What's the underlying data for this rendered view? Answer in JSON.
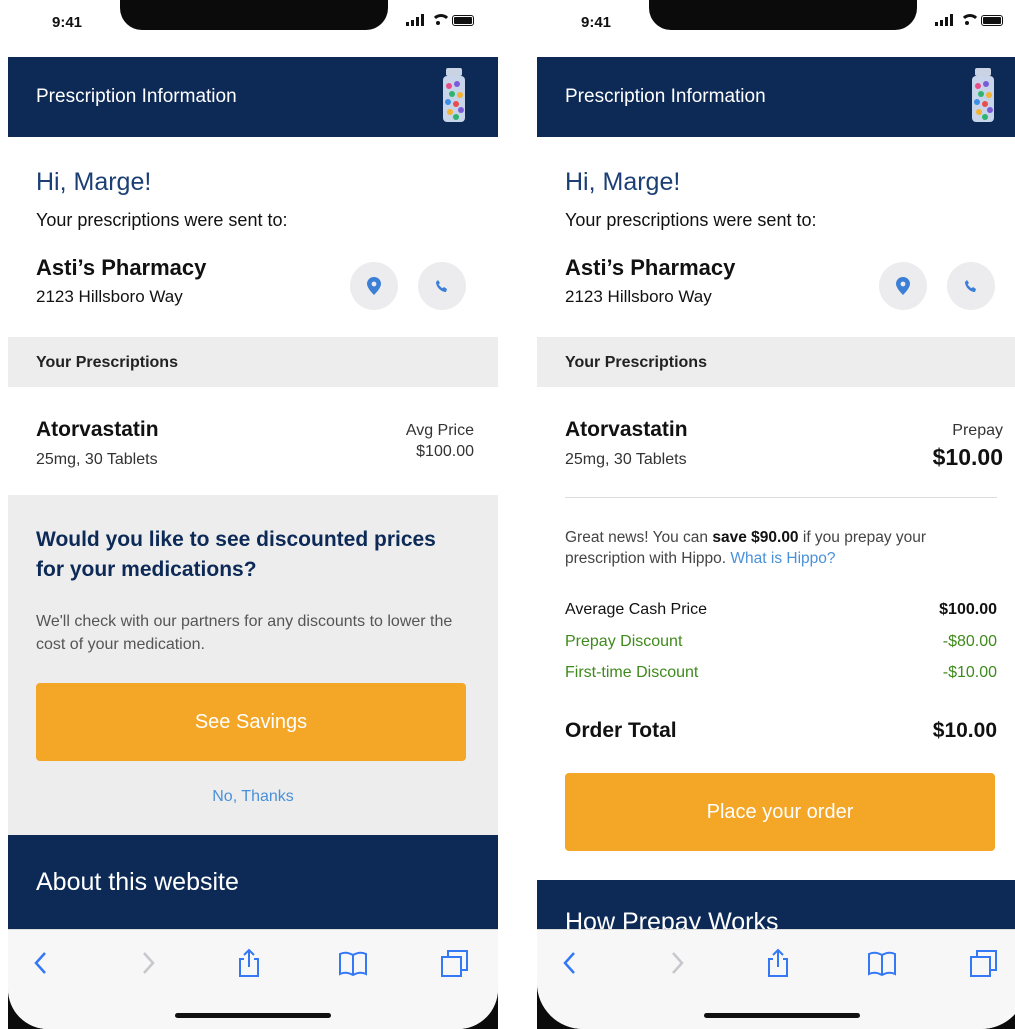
{
  "status_bar": {
    "time": "9:41"
  },
  "header": {
    "title": "Prescription Information",
    "logo_icon": "pill-bottle-icon"
  },
  "greeting": {
    "hello": "Hi, Marge!",
    "sent_to": "Your prescriptions were sent to:"
  },
  "pharmacy": {
    "name": "Asti’s Pharmacy",
    "address": "2123 Hillsboro Way",
    "location_icon": "location-pin-icon",
    "phone_icon": "phone-icon"
  },
  "section": {
    "title": "Your Prescriptions"
  },
  "prescription": {
    "name": "Atorvastatin",
    "details": "25mg, 30 Tablets"
  },
  "left_screen": {
    "price_label": "Avg Price",
    "price_value": "$100.00",
    "question": "Would you like to see discounted prices for your medications?",
    "description": "We'll check with our partners for any discounts to lower the cost of your medication.",
    "primary_button": "See Savings",
    "secondary_link": "No, Thanks",
    "footer_title": "About this website"
  },
  "right_screen": {
    "price_label": "Prepay",
    "price_value": "$10.00",
    "news_prefix": "Great news! You can",
    "news_bold": "save $90.00",
    "news_suffix": "if you prepay your prescription with Hippo.",
    "news_link": "What is Hippo?",
    "lines": [
      {
        "label": "Average Cash Price",
        "value": "$100.00"
      },
      {
        "label": "Prepay Discount",
        "value": "-$80.00"
      },
      {
        "label": "First-time Discount",
        "value": "-$10.00"
      }
    ],
    "total_label": "Order Total",
    "total_value": "$10.00",
    "primary_button": "Place your order",
    "footer_title": "How Prepay Works"
  },
  "toolbar": {
    "icons": [
      "back-chevron-icon",
      "forward-chevron-icon",
      "share-icon",
      "bookmarks-icon",
      "tabs-icon"
    ]
  },
  "colors": {
    "navy": "#0d2a57",
    "heading_blue": "#1b3f75",
    "accent_orange": "#f4a626",
    "link_blue": "#4a90d9",
    "discount_green": "#3f8a1c",
    "section_gray": "#ededee"
  }
}
